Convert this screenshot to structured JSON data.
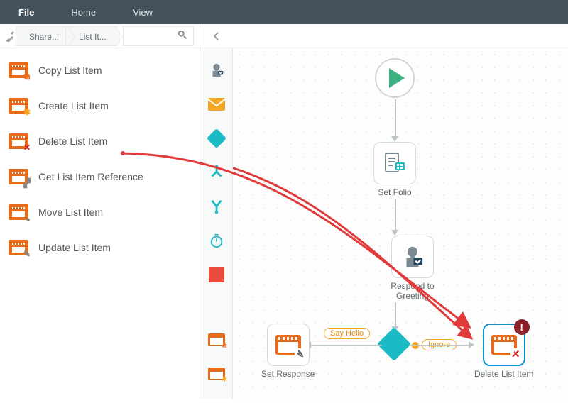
{
  "menu": {
    "file": "File",
    "home": "Home",
    "view": "View"
  },
  "breadcrumb": {
    "first": "Share...",
    "second": "List It..."
  },
  "sidelist": {
    "items": [
      {
        "label": "Copy List Item",
        "badge": "⧉",
        "badgeClass": "b-copy"
      },
      {
        "label": "Create List Item",
        "badge": "✱",
        "badgeClass": "b-new"
      },
      {
        "label": "Delete List Item",
        "badge": "✕",
        "badgeClass": "b-del"
      },
      {
        "label": "Get List Item Reference",
        "badge": "🔗",
        "badgeClass": "b-ref"
      },
      {
        "label": "Move List Item",
        "badge": "↘",
        "badgeClass": "b-move"
      },
      {
        "label": "Update List Item",
        "badge": "✎",
        "badgeClass": "b-upd"
      }
    ]
  },
  "vstrip": {
    "iconMail": "✉",
    "iconForms": "",
    "iconDown": "⬇",
    "iconMerge": "⤵",
    "iconClock": "⏱"
  },
  "canvas": {
    "setFolio": "Set Folio",
    "respond": "Respond to Greeting",
    "sayHello": "Say Hello",
    "ignore": "Ignore",
    "setResp": "Set Response",
    "deleteLI": "Delete List Item"
  }
}
